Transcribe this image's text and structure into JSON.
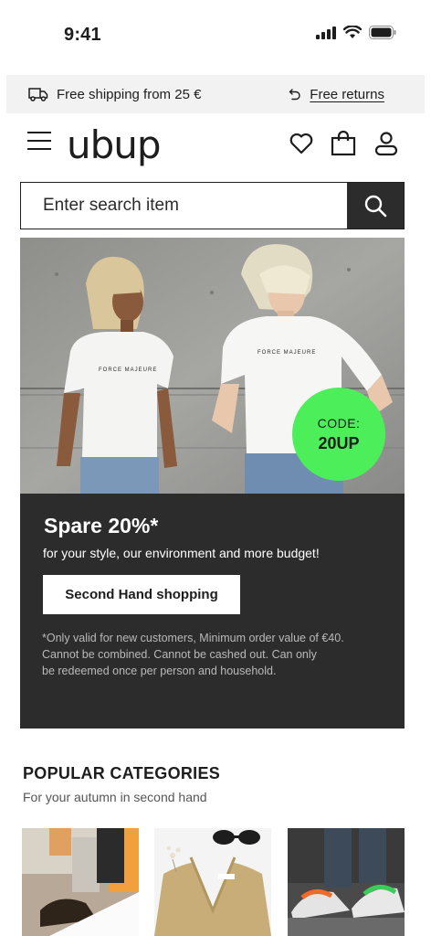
{
  "status_bar": {
    "time": "9:41"
  },
  "promo_bar": {
    "shipping_text": "Free shipping from 25 €",
    "returns_text": "Free returns"
  },
  "header": {
    "logo": "ubup",
    "icons": [
      "menu-icon",
      "heart-icon",
      "shopping-bag-icon",
      "user-icon"
    ]
  },
  "search": {
    "placeholder": "Enter search item"
  },
  "hero": {
    "code_label": "CODE:",
    "code_value": "20UP",
    "shirt_print": "FORCE MAJEURE",
    "badge_color": "#4cef5a"
  },
  "promo": {
    "title": "Spare 20%*",
    "subtitle": "for your style, our environment and more budget!",
    "cta_label": "Second Hand shopping",
    "fine_print": [
      "*Only valid for new customers, Minimum order value of €40.",
      "Cannot be combined. Cannot be cashed out. Can only",
      "be redeemed once per person and household."
    ]
  },
  "categories": {
    "title": "POPULAR CATEGORIES",
    "subtitle": "For your autumn in second hand"
  }
}
